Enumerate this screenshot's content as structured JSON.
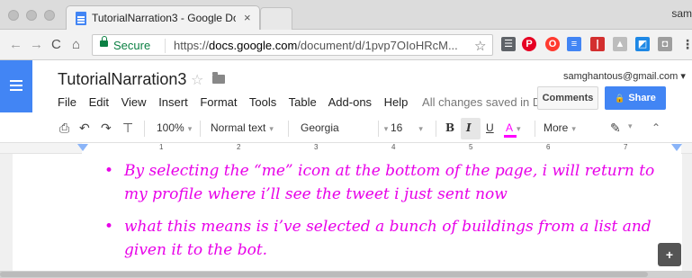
{
  "browser": {
    "tab_title": "TutorialNarration3 - Google Do",
    "tab_close": "×",
    "user_chip": "sam",
    "secure_label": "Secure",
    "url_scheme": "https://",
    "url_host": "docs.google.com",
    "url_path": "/document/d/1pvp7OIoHRcM...",
    "nav": {
      "back": "←",
      "forward": "→",
      "reload": "C",
      "home": "⌂"
    },
    "bookmark_star": "☆",
    "extensions": [
      {
        "icon": "reader-icon",
        "glyph": "☰",
        "color": "#5f6368"
      },
      {
        "icon": "pinterest-icon",
        "glyph": "P",
        "color": "#e60023"
      },
      {
        "icon": "opera-icon",
        "glyph": "O",
        "color": "#ff3b30"
      },
      {
        "icon": "docs-ext-icon",
        "glyph": "≡",
        "color": "#4285f4"
      },
      {
        "icon": "trello-icon",
        "glyph": "|",
        "color": "#d32f2f"
      },
      {
        "icon": "drive-icon",
        "glyph": "▲",
        "color": "#bdbdbd"
      },
      {
        "icon": "photos-icon",
        "glyph": "◩",
        "color": "#1e88e5"
      },
      {
        "icon": "camera-icon",
        "glyph": "◘",
        "color": "#9e9e9e"
      }
    ],
    "menu_dots": "⋮"
  },
  "docs": {
    "title": "TutorialNarration3",
    "title_star": "☆",
    "account_email": "samghantous@gmail.com ▾",
    "menu": [
      "File",
      "Edit",
      "View",
      "Insert",
      "Format",
      "Tools",
      "Table",
      "Add-ons",
      "Help"
    ],
    "save_status": "All changes saved in Dr...",
    "comments_label": "Comments",
    "share_label": "Share",
    "share_icon": "🔒"
  },
  "toolbar": {
    "zoom": "100%",
    "style": "Normal text",
    "font": "Georgia",
    "size": "16",
    "bold": "B",
    "italic": "I",
    "underline": "U",
    "text_color": "A",
    "more": "More",
    "caret": "▾",
    "collapse": "⌃"
  },
  "ruler": {
    "numbers": [
      "1",
      "2",
      "3",
      "4",
      "5",
      "6",
      "7"
    ]
  },
  "document": {
    "text_color": "#e800e8",
    "bullets": [
      "By selecting the “me” icon at the bottom of the page, i will return to my profile where i’ll see the tweet i just sent now",
      "what this means is i’ve selected a bunch of buildings from a list and given it to the bot."
    ]
  }
}
